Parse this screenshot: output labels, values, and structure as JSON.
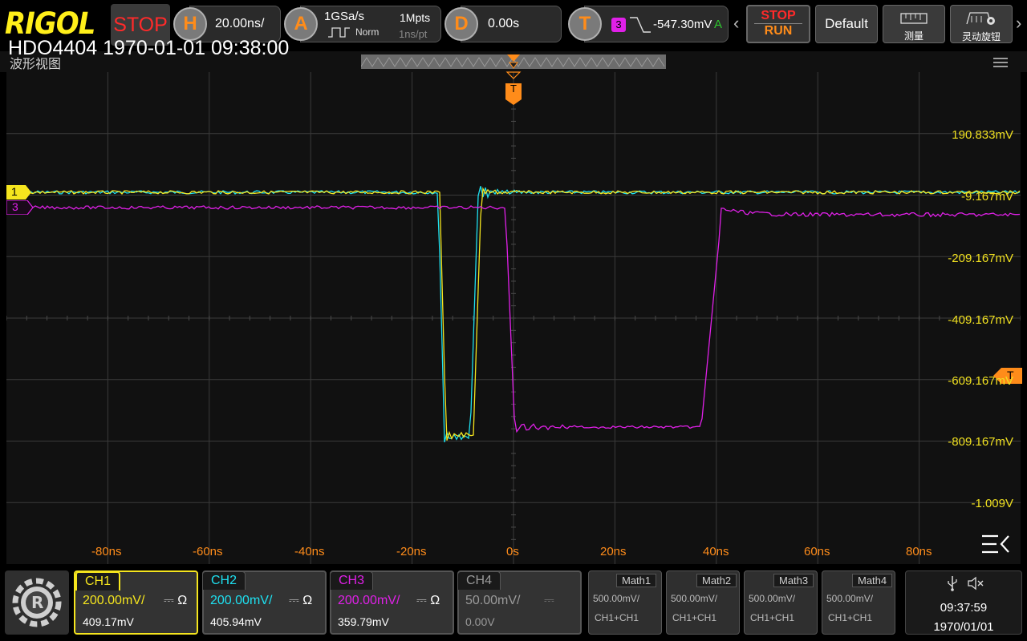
{
  "brand": {
    "logo": "RIGOL",
    "run_state": "STOP",
    "model_timestamp": "HDO4404 1970-01-01 09:38:00"
  },
  "horizontal": {
    "letter": "H",
    "scale": "20.00ns/"
  },
  "acquire": {
    "letter": "A",
    "sample_rate": "1GSa/s",
    "mode": "Norm",
    "depth": "1Mpts",
    "interval": "1ns/pt"
  },
  "delay": {
    "letter": "D",
    "value": "0.00s"
  },
  "trigger": {
    "letter": "T",
    "source": "3",
    "level": "-547.30mV",
    "mode": "A"
  },
  "toolbar": {
    "stop_label": "STOP",
    "run_label": "RUN",
    "default_label": "Default",
    "measure_label": "测量",
    "knob_label": "灵动旋钮",
    "left_arrow": "‹",
    "right_arrow": "›"
  },
  "waveform": {
    "title": "波形视图",
    "trigger_marker": "T",
    "ch1_marker": "1",
    "ch3_marker": "3",
    "level_marker": "T",
    "y_labels": [
      "190.833mV",
      "-9.167mV",
      "-209.167mV",
      "-409.167mV",
      "-609.167mV",
      "-809.167mV",
      "-1.009V"
    ],
    "x_labels": [
      "-80ns",
      "-60ns",
      "-40ns",
      "-20ns",
      "0s",
      "20ns",
      "40ns",
      "60ns",
      "80ns"
    ]
  },
  "channels": [
    {
      "name": "CH1",
      "scale": "200.00mV/",
      "coupling": "Ω",
      "offset": "409.17mV",
      "color": "#f5e51e",
      "active": true
    },
    {
      "name": "CH2",
      "scale": "200.00mV/",
      "coupling": "Ω",
      "offset": "405.94mV",
      "color": "#1ee0f0",
      "active": false
    },
    {
      "name": "CH3",
      "scale": "200.00mV/",
      "coupling": "Ω",
      "offset": "359.79mV",
      "color": "#e020e8",
      "active": false
    },
    {
      "name": "CH4",
      "scale": "50.00mV/",
      "coupling": "",
      "offset": "0.00V",
      "color": "#9a9a9a",
      "active": false
    }
  ],
  "math": [
    {
      "name": "Math1",
      "scale": "500.00mV/",
      "source": "CH1+CH1"
    },
    {
      "name": "Math2",
      "scale": "500.00mV/",
      "source": "CH1+CH1"
    },
    {
      "name": "Math3",
      "scale": "500.00mV/",
      "source": "CH1+CH1"
    },
    {
      "name": "Math4",
      "scale": "500.00mV/",
      "source": "CH1+CH1"
    }
  ],
  "status": {
    "time": "09:37:59",
    "date": "1970/01/01",
    "usb_icon": "usb-icon",
    "mute_icon": "speaker-mute-icon"
  },
  "colors": {
    "ch1": "#f5e51e",
    "ch2": "#1ee0f0",
    "ch3": "#e020e8",
    "accent": "#ff8c1a",
    "stop": "#ff2a2a"
  }
}
